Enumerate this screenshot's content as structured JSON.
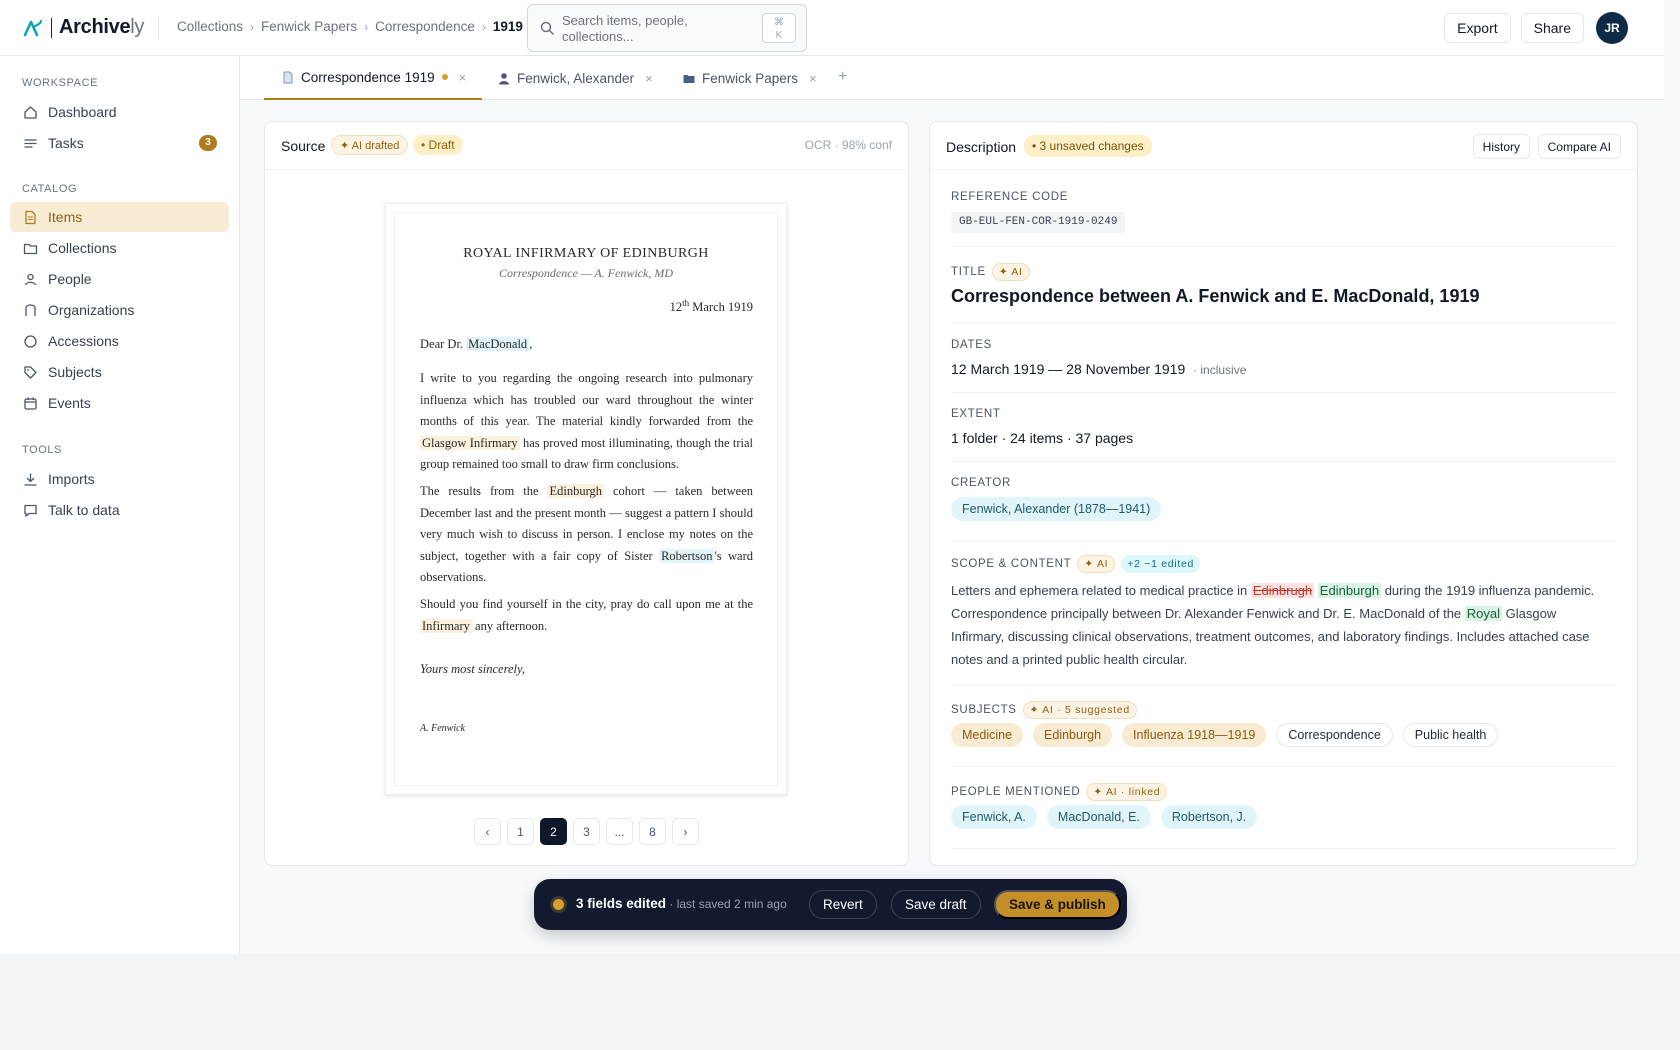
{
  "app": {
    "name_main": "Archive",
    "name_tail": "ly"
  },
  "breadcrumb": [
    "Collections",
    "Fenwick Papers",
    "Correspondence",
    "1919"
  ],
  "search": {
    "placeholder": "Search items, people, collections...",
    "shortcut": "⌘\nK"
  },
  "header": {
    "export_label": "Export",
    "share_label": "Share",
    "avatar_initials": "JR"
  },
  "sidebar": {
    "workspace_label": "WORKSPACE",
    "catalog_label": "CATALOG",
    "tools_label": "TOOLS",
    "workspace": [
      {
        "label": "Dashboard",
        "icon": "home-icon"
      },
      {
        "label": "Tasks",
        "icon": "list-icon",
        "badge": "3"
      }
    ],
    "catalog": [
      {
        "label": "Items",
        "icon": "document-icon",
        "active": true
      },
      {
        "label": "Collections",
        "icon": "folder-icon"
      },
      {
        "label": "People",
        "icon": "person-icon"
      },
      {
        "label": "Organizations",
        "icon": "building-icon"
      },
      {
        "label": "Accessions",
        "icon": "accession-icon"
      },
      {
        "label": "Subjects",
        "icon": "tag-icon"
      },
      {
        "label": "Events",
        "icon": "calendar-icon"
      }
    ],
    "tools": [
      {
        "label": "Imports",
        "icon": "download-icon"
      },
      {
        "label": "Talk to data",
        "icon": "chat-icon"
      }
    ]
  },
  "tabs": [
    {
      "label": "Correspondence 1919",
      "icon": "document-icon",
      "unsaved": true,
      "active": true
    },
    {
      "label": "Fenwick, Alexander",
      "icon": "person-icon"
    },
    {
      "label": "Fenwick Papers",
      "icon": "folder-icon"
    }
  ],
  "tab_add": "+",
  "tab_close": "×",
  "source": {
    "title": "Source",
    "ai_badge": "✦ AI drafted",
    "draft_badge": "• Draft",
    "ocr": "OCR · 98% conf",
    "letter": {
      "heading": "ROYAL INFIRMARY OF EDINBURGH",
      "subheading": "Correspondence — A. Fenwick, MD",
      "date_day": "12",
      "date_sup": "th",
      "date_rest": " March 1919",
      "salutation_pre": "Dear Dr. ",
      "salutation_name": "MacDonald",
      "salutation_post": ",",
      "p1_a": "I write to you regarding the ongoing research into pulmonary influenza which has troubled our ward throughout the winter months of this year. The material kindly forwarded from the ",
      "p1_hl": "Glasgow Infirmary",
      "p1_b": " has proved most illuminating, though the trial group remained too small to draw firm conclusions.",
      "p2_a": "The results from the ",
      "p2_hl": "Edinburgh",
      "p2_b": " cohort — taken between December last and the present month — suggest a pattern I should very much wish to discuss in person. I enclose my notes on the subject, together with a fair copy of Sister ",
      "p2_name": "Robertson",
      "p2_c": "'s ward observations.",
      "p3_a": "Should you find yourself in the city, pray do call upon me at the ",
      "p3_hl": "Infirmary",
      "p3_b": " any afternoon.",
      "closing": "Yours most sincerely,",
      "signature": "A. Fenwick"
    },
    "pager": [
      "‹",
      "1",
      "2",
      "3",
      "...",
      "8",
      "›"
    ],
    "pager_active": "2"
  },
  "description": {
    "title": "Description",
    "unsaved_badge": "• 3 unsaved changes",
    "history_label": "History",
    "compare_label": "Compare AI",
    "ref_label": "REFERENCE CODE",
    "ref_value": "GB-EUL-FEN-COR-1919-0249",
    "title_label": "TITLE",
    "ai_tag": "✦ AI",
    "title_value": "Correspondence between A. Fenwick and E. MacDonald, 1919",
    "dates_label": "DATES",
    "dates_value": "12 March 1919 — 28 November 1919",
    "dates_note": "· inclusive",
    "extent_label": "EXTENT",
    "extent_value": "1 folder · 24 items · 37 pages",
    "creator_label": "CREATOR",
    "creator_value": "Fenwick, Alexander (1878—1941)",
    "scope_label": "SCOPE & CONTENT",
    "scope_edit_badge": "+2 −1 edited",
    "scope_a": "Letters and ephemera related to medical practice in ",
    "scope_del": "Edinbrugh",
    "scope_ins": "Edinburgh",
    "scope_b": " during the 1919 influenza pandemic. Correspondence principally between Dr. Alexander Fenwick and Dr. E. MacDonald of the ",
    "scope_ins2": "Royal",
    "scope_c": " Glasgow Infirmary, discussing clinical observations, treatment outcomes, and laboratory findings. Includes attached case notes and a printed public health circular.",
    "subjects_label": "SUBJECTS",
    "subjects_badge": "✦ AI · 5 suggested",
    "subjects": [
      {
        "label": "Medicine",
        "ai": true
      },
      {
        "label": "Edinburgh",
        "ai": true
      },
      {
        "label": "Influenza 1918—1919",
        "ai": true
      },
      {
        "label": "Correspondence",
        "ai": false
      },
      {
        "label": "Public health",
        "ai": false
      }
    ],
    "people_label": "PEOPLE MENTIONED",
    "people_badge": "✦ AI · linked",
    "people": [
      "Fenwick, A.",
      "MacDonald, E.",
      "Robertson, J."
    ]
  },
  "savebar": {
    "status": "3 fields edited",
    "sub": " · last saved 2 min ago",
    "revert": "Revert",
    "save_draft": "Save draft",
    "publish": "Save & publish"
  },
  "colors": {
    "accent": "#b07a1e",
    "navy": "#0f172a",
    "active_nav_bg": "#f8ecd4"
  }
}
